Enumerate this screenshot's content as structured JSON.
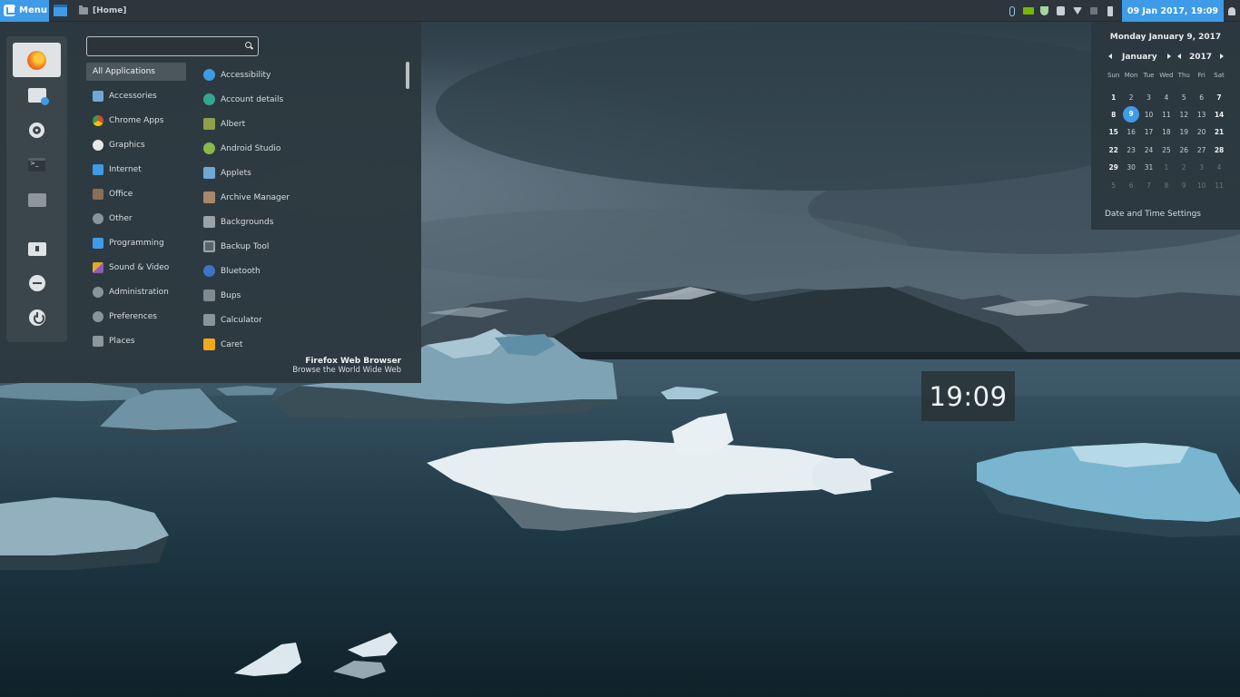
{
  "panel": {
    "menu_label": "Menu",
    "window_title": "[Home]",
    "clock": "09 Jan 2017, 19:09"
  },
  "menu": {
    "search": {
      "value": "",
      "placeholder": ""
    },
    "favorites": [
      {
        "name": "firefox",
        "icon": "firefox-icon"
      },
      {
        "name": "software-manager",
        "icon": "software-manager-icon"
      },
      {
        "name": "system-settings",
        "icon": "settings-icon"
      },
      {
        "name": "terminal",
        "icon": "terminal-icon"
      },
      {
        "name": "files",
        "icon": "folder-icon"
      },
      {
        "name": "lock-screen",
        "icon": "lock-screen-icon"
      },
      {
        "name": "logout",
        "icon": "logout-icon"
      },
      {
        "name": "shutdown",
        "icon": "power-icon"
      }
    ],
    "categories": [
      {
        "label": "All Applications",
        "selected": true
      },
      {
        "label": "Accessories",
        "icon": "accessories-icon",
        "color": "#6fa8d6"
      },
      {
        "label": "Chrome Apps",
        "icon": "chrome-icon",
        "color": "#e0a928"
      },
      {
        "label": "Graphics",
        "icon": "graphics-icon",
        "color": "#e8e8e8"
      },
      {
        "label": "Internet",
        "icon": "internet-icon",
        "color": "#3d9be8"
      },
      {
        "label": "Office",
        "icon": "office-icon",
        "color": "#8b6e56"
      },
      {
        "label": "Other",
        "icon": "other-icon",
        "color": "#8a959a"
      },
      {
        "label": "Programming",
        "icon": "programming-icon",
        "color": "#3d9be8"
      },
      {
        "label": "Sound & Video",
        "icon": "sound-video-icon",
        "color": "#e0a928"
      },
      {
        "label": "Administration",
        "icon": "administration-icon",
        "color": "#8a959a"
      },
      {
        "label": "Preferences",
        "icon": "preferences-icon",
        "color": "#8a959a"
      },
      {
        "label": "Places",
        "icon": "places-icon",
        "color": "#8c969c"
      }
    ],
    "apps": [
      {
        "label": "Accessibility",
        "icon": "accessibility-icon",
        "color": "#3d9be8"
      },
      {
        "label": "Account details",
        "icon": "account-icon",
        "color": "#35a68f"
      },
      {
        "label": "Albert",
        "icon": "albert-icon",
        "color": "#8da04a"
      },
      {
        "label": "Android Studio",
        "icon": "android-studio-icon",
        "color": "#8ab84a"
      },
      {
        "label": "Applets",
        "icon": "applets-icon",
        "color": "#6fa8d6"
      },
      {
        "label": "Archive Manager",
        "icon": "archive-manager-icon",
        "color": "#a8876a"
      },
      {
        "label": "Backgrounds",
        "icon": "backgrounds-icon",
        "color": "#9aa3a8"
      },
      {
        "label": "Backup Tool",
        "icon": "backup-tool-icon",
        "color": "#5a656b"
      },
      {
        "label": "Bluetooth",
        "icon": "bluetooth-icon",
        "color": "#3d74c8"
      },
      {
        "label": "Bups",
        "icon": "bups-icon",
        "color": "#7e8a90"
      },
      {
        "label": "Calculator",
        "icon": "calculator-icon",
        "color": "#8a959a"
      },
      {
        "label": "Caret",
        "icon": "caret-icon",
        "color": "#f2a81d"
      }
    ],
    "description": {
      "title": "Firefox Web Browser",
      "subtitle": "Browse the World Wide Web"
    }
  },
  "calendar": {
    "date_label": "Monday January 9, 2017",
    "month": "January",
    "year": "2017",
    "weekdays": [
      "Sun",
      "Mon",
      "Tue",
      "Wed",
      "Thu",
      "Fri",
      "Sat"
    ],
    "weeks": [
      [
        "1",
        "2",
        "3",
        "4",
        "5",
        "6",
        "7"
      ],
      [
        "8",
        "9",
        "10",
        "11",
        "12",
        "13",
        "14"
      ],
      [
        "15",
        "16",
        "17",
        "18",
        "19",
        "20",
        "21"
      ],
      [
        "22",
        "23",
        "24",
        "25",
        "26",
        "27",
        "28"
      ],
      [
        "29",
        "30",
        "31",
        "1",
        "2",
        "3",
        "4"
      ],
      [
        "5",
        "6",
        "7",
        "8",
        "9",
        "10",
        "11"
      ]
    ],
    "today": "9",
    "settings_link": "Date and Time Settings"
  },
  "desklet": {
    "time": "19:09"
  },
  "colors": {
    "accent": "#3d9be8",
    "panel": "#2c363c",
    "menu_bg": "#2c383e"
  }
}
